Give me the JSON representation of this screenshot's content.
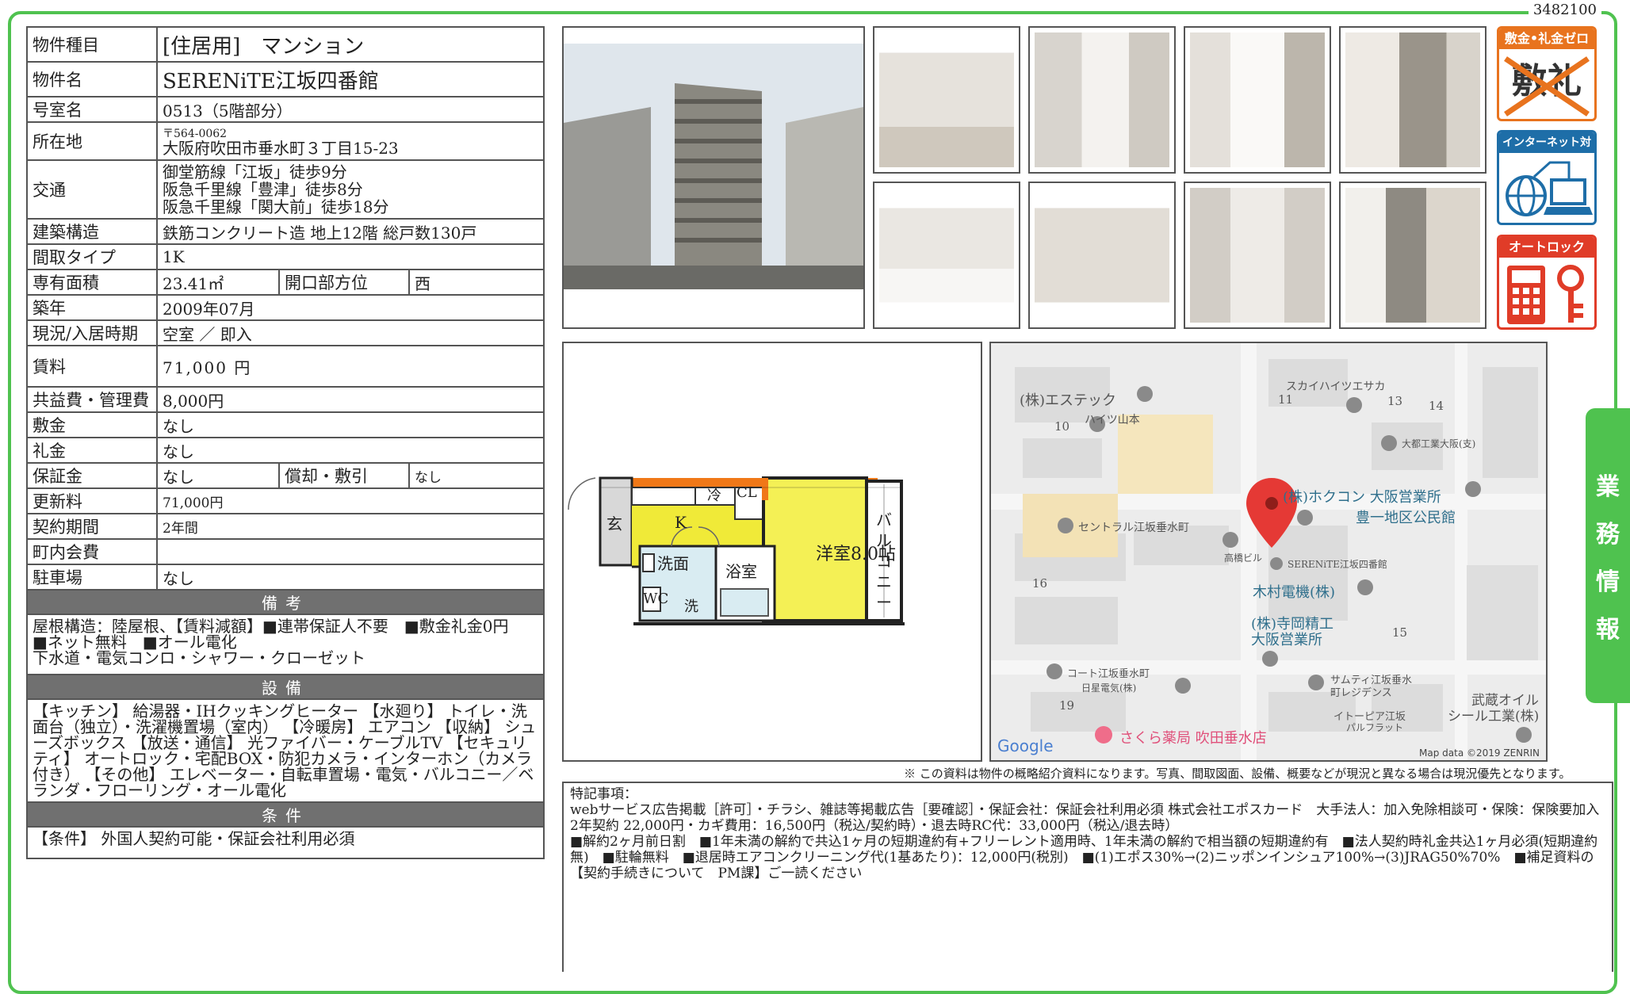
{
  "doc_code": "3482100",
  "property": {
    "type_label": "物件種目",
    "type_value": "[住居用]　マンション",
    "name_label": "物件名",
    "name_value": "SERENiTE江坂四番館",
    "room_label": "号室名",
    "room_value": "0513（5階部分）",
    "address_label": "所在地",
    "postal": "〒564-0062",
    "address_value": "大阪府吹田市垂水町３丁目15-23",
    "transport_label": "交通",
    "transport_lines": [
      "御堂筋線「江坂」徒歩9分",
      "阪急千里線「豊津」徒歩8分",
      "阪急千里線「関大前」徒歩18分"
    ],
    "structure_label": "建築構造",
    "structure_value": "鉄筋コンクリート造 地上12階 総戸数130戸",
    "layout_label": "間取タイプ",
    "layout_value": "1K",
    "area_label": "専有面積",
    "area_value": "23.41㎡",
    "opening_label": "開口部方位",
    "opening_value": "西",
    "built_label": "築年",
    "built_value": "2009年07月",
    "status_label": "現況/入居時期",
    "status_value": "空室 ／ 即入",
    "rent_label": "賃料",
    "rent_value": "71,000 円",
    "fee_label": "共益費・管理費",
    "fee_value": "8,000円",
    "deposit_label": "敷金",
    "deposit_value": "なし",
    "keymoney_label": "礼金",
    "keymoney_value": "なし",
    "guarantee_label": "保証金",
    "guarantee_value": "なし",
    "amort_label": "償却・敷引",
    "amort_value": "なし",
    "renewal_label": "更新料",
    "renewal_value": "71,000円",
    "term_label": "契約期間",
    "term_value": "2年間",
    "community_label": "町内会費",
    "community_value": "",
    "parking_label": "駐車場",
    "parking_value": "なし"
  },
  "remarks": {
    "header": "備考",
    "body": "屋根構造：陸屋根、【賃料減額】■連帯保証人不要　■敷金礼金0円　■ネット無料　■オール電化\n下水道・電気コンロ・シャワー・クローゼット"
  },
  "equipment": {
    "header": "設備",
    "body": "【キッチン】 給湯器・IHクッキングヒーター 【水廻り】 トイレ・洗面台（独立）・洗濯機置場（室内） 【冷暖房】 エアコン 【収納】 シューズボックス 【放送・通信】 光ファイバー・ケーブルTV 【セキュリティ】 オートロック・宅配BOX・防犯カメラ・インターホン（カメラ付き） 【その他】 エレベーター・自転車置場・電気・バルコニー／ベランダ・フローリング・オール電化"
  },
  "conditions": {
    "header": "条件",
    "body": "【条件】 外国人契約可能・保証会社利用必須"
  },
  "badges": [
    {
      "title": "敷金•礼金ゼロ",
      "glyph": "敷礼",
      "color": "#e8731e"
    },
    {
      "title": "インターネット対応",
      "color": "#1e6ea8"
    },
    {
      "title": "オートロック",
      "color": "#e03c28"
    }
  ],
  "floorplan": {
    "genkan": "玄",
    "kitchen": "K",
    "fridge": "冷",
    "closet": "CL",
    "washroom": "洗面",
    "bath": "浴室",
    "wc": "WC",
    "laundry": "洗",
    "room": "洋室8.0帖",
    "balcony": "バルコニー"
  },
  "map": {
    "labels": [
      "(株)エステック",
      "ハイツ山本",
      "スカイハイツエサカ",
      "大都工業大阪(支)",
      "(株)ホクコン 大阪営業所",
      "豊一地区公民館",
      "セントラル江坂垂水町",
      "高橋ビル",
      "SERENiTE江坂四番館",
      "木村電機(株)",
      "(株)寺岡精工",
      "大阪営業所",
      "コート江坂垂水町",
      "日星電気(株)",
      "サムティ江坂垂水",
      "町レジデンス",
      "武蔵オイル",
      "シール工業(株)",
      "イトーピア江坂",
      "パルフラット",
      "さくら薬局 吹田垂水店"
    ],
    "blocks": [
      "10",
      "11",
      "13",
      "14",
      "16",
      "15",
      "19"
    ],
    "google": "Google",
    "credit": "Map data ©2019 ZENRIN"
  },
  "disclaimer": "※ この資料は物件の概略紹介資料になります。写真、間取図面、設備、概要などが現況と異なる場合は現況優先となります。",
  "special": {
    "heading": "特記事項：",
    "body": "webサービス広告掲載［許可］・チラシ、雑誌等掲載広告［要確認］・保証会社：保証会社利用必須 株式会社エポスカード　大手法人：加入免除相談可・保険：保険要加入 2年契約 22,000円・カギ費用：16,500円（税込/契約時）・退去時RC代：33,000円（税込/退去時）\n■解約2ヶ月前日割　■1年未満の解約で共込1ヶ月の短期違約有+フリーレント適用時、1年未満の解約で相当額の短期違約有　■法人契約時礼金共込1ヶ月必須(短期違約無)　■駐輪無料　■退居時エアコンクリーニング代(1基あたり)：12,000円(税別)　■(1)エポス30%→(2)ニッポンインシュア100%→(3)JRAG50%70%　■補足資料の【契約手続きについて　PM課】ご一読ください"
  },
  "side_tab": [
    "業",
    "務",
    "情",
    "報"
  ]
}
